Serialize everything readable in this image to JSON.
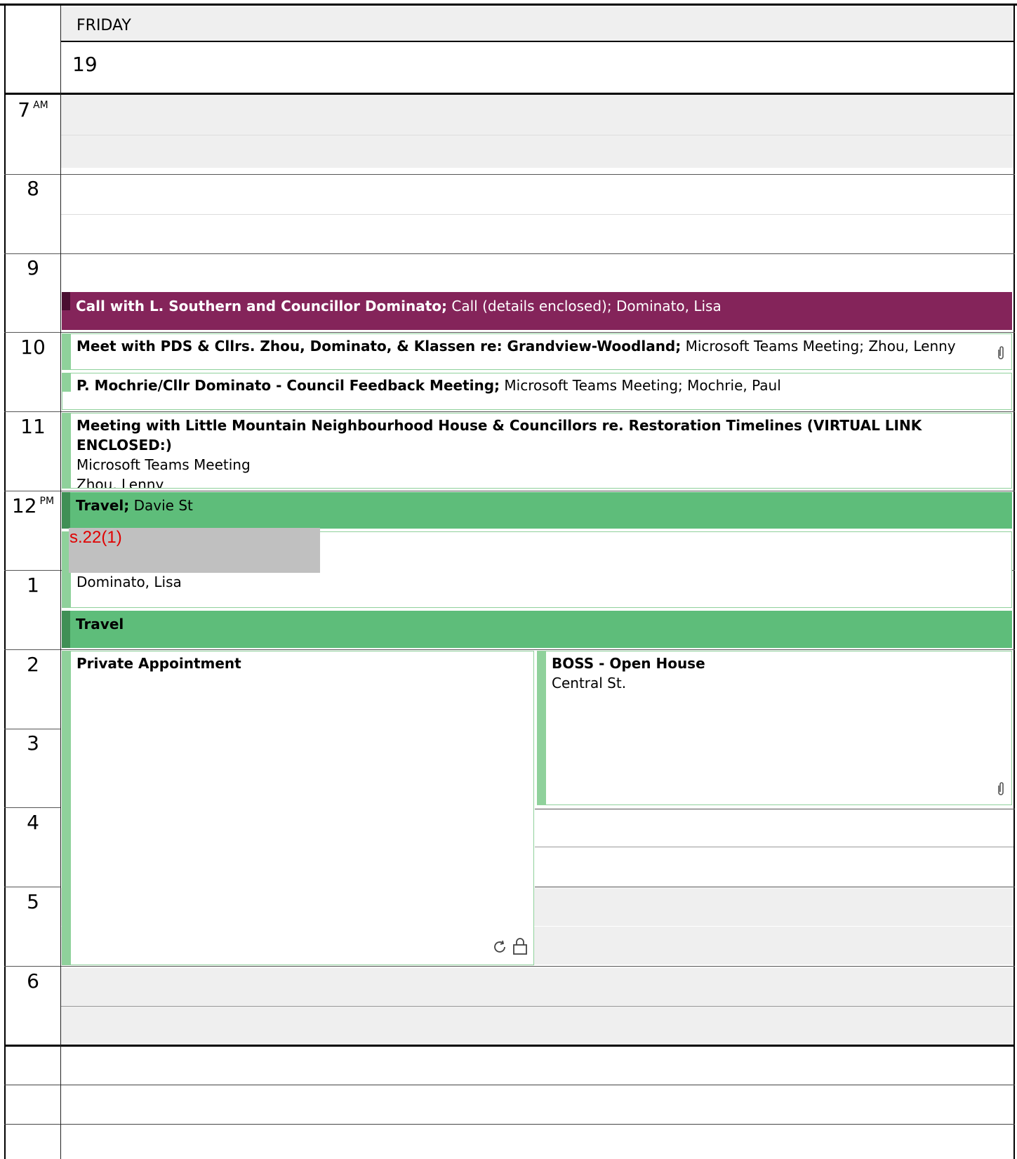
{
  "day": {
    "name": "FRIDAY",
    "date": "19"
  },
  "hours": [
    {
      "label": "7",
      "suffix": "AM"
    },
    {
      "label": "8",
      "suffix": ""
    },
    {
      "label": "9",
      "suffix": ""
    },
    {
      "label": "10",
      "suffix": ""
    },
    {
      "label": "11",
      "suffix": ""
    },
    {
      "label": "12",
      "suffix": "PM"
    },
    {
      "label": "1",
      "suffix": ""
    },
    {
      "label": "2",
      "suffix": ""
    },
    {
      "label": "3",
      "suffix": ""
    },
    {
      "label": "4",
      "suffix": ""
    },
    {
      "label": "5",
      "suffix": ""
    },
    {
      "label": "6",
      "suffix": ""
    }
  ],
  "events": {
    "call_southern": {
      "title": "Call with L. Southern and Councillor Dominato;",
      "details": " Call (details enclosed); Dominato, Lisa"
    },
    "pds_meeting": {
      "title": "Meet with PDS & Cllrs. Zhou, Dominato, & Klassen re: Grandview-Woodland;",
      "details": " Microsoft Teams Meeting; Zhou, Lenny"
    },
    "mochrie": {
      "title": "P. Mochrie/Cllr Dominato - Council Feedback Meeting;",
      "details": " Microsoft Teams Meeting; Mochrie, Paul"
    },
    "little_mountain": {
      "title": "Meeting with Little Mountain Neighbourhood House & Councillors re. Restoration Timelines (VIRTUAL LINK ENCLOSED:)",
      "location": "Microsoft Teams Meeting",
      "organizer": "Zhou, Lenny"
    },
    "travel_davie": {
      "title": "Travel;",
      "details": " Davie St"
    },
    "redacted": {
      "redaction_label": "s.22(1)",
      "organizer": "Dominato, Lisa"
    },
    "travel2": {
      "title": "Travel"
    },
    "private": {
      "title": "Private Appointment"
    },
    "boss": {
      "title": "BOSS - Open House",
      "location": "Central St."
    }
  },
  "colors": {
    "purple_event": "#84245a",
    "purple_strip": "#4a0f31",
    "green_event": "#5ebd7a",
    "green_strip": "#3f8f55",
    "light_green_strip": "#8fd19b",
    "event_border": "#8fd19b"
  },
  "icons": {
    "attachment": "paperclip-icon",
    "recurring": "recurring-icon",
    "private": "lock-icon"
  }
}
